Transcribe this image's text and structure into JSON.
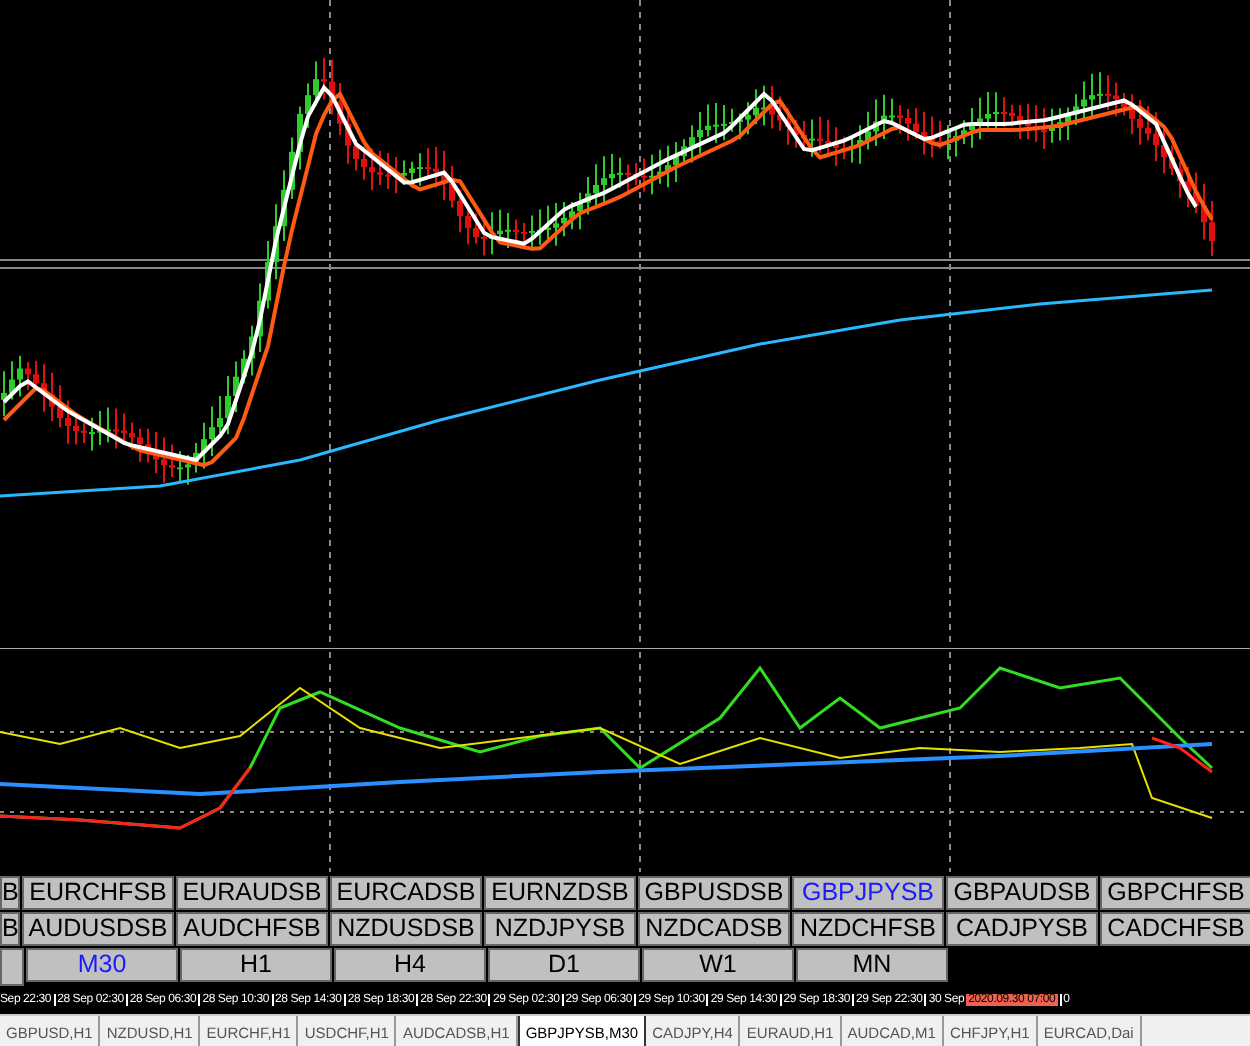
{
  "symbol_buttons": [
    [
      {
        "label": "B",
        "selected": false
      },
      {
        "label": "EURCHFSB",
        "selected": false
      },
      {
        "label": "EURAUDSB",
        "selected": false
      },
      {
        "label": "EURCADSB",
        "selected": false
      },
      {
        "label": "EURNZDSB",
        "selected": false
      },
      {
        "label": "GBPUSDSB",
        "selected": false
      },
      {
        "label": "GBPJPYSB",
        "selected": true
      },
      {
        "label": "GBPAUDSB",
        "selected": false
      },
      {
        "label": "GBPCHFSB",
        "selected": false
      }
    ],
    [
      {
        "label": "B",
        "selected": false
      },
      {
        "label": "AUDUSDSB",
        "selected": false
      },
      {
        "label": "AUDCHFSB",
        "selected": false
      },
      {
        "label": "NZDUSDSB",
        "selected": false
      },
      {
        "label": "NZDJPYSB",
        "selected": false
      },
      {
        "label": "NZDCADSB",
        "selected": false
      },
      {
        "label": "NZDCHFSB",
        "selected": false
      },
      {
        "label": "CADJPYSB",
        "selected": false
      },
      {
        "label": "CADCHFSB",
        "selected": false
      }
    ]
  ],
  "timeframe_buttons": [
    {
      "label": "M30",
      "selected": true
    },
    {
      "label": "H1",
      "selected": false
    },
    {
      "label": "H4",
      "selected": false
    },
    {
      "label": "D1",
      "selected": false
    },
    {
      "label": "W1",
      "selected": false
    },
    {
      "label": "MN",
      "selected": false
    }
  ],
  "time_axis": {
    "labels": [
      "Sep 22:30",
      "28 Sep 02:30",
      "28 Sep 06:30",
      "28 Sep 10:30",
      "28 Sep 14:30",
      "28 Sep 18:30",
      "28 Sep 22:30",
      "29 Sep 02:30",
      "29 Sep 06:30",
      "29 Sep 10:30",
      "29 Sep 14:30",
      "29 Sep 18:30",
      "29 Sep 22:30",
      "30 Sep"
    ],
    "current_time": "2020.09.30 07:00",
    "trailing": "0"
  },
  "tabs": [
    {
      "label": "GBPUSD,H1",
      "selected": false
    },
    {
      "label": "NZDUSD,H1",
      "selected": false
    },
    {
      "label": "EURCHF,H1",
      "selected": false
    },
    {
      "label": "USDCHF,H1",
      "selected": false
    },
    {
      "label": "AUDCADSB,H1",
      "selected": false
    },
    {
      "label": "GBPJPYSB,M30",
      "selected": true
    },
    {
      "label": "CADJPY,H4",
      "selected": false
    },
    {
      "label": "EURAUD,H1",
      "selected": false
    },
    {
      "label": "AUDCAD,M1",
      "selected": false
    },
    {
      "label": "CHFJPY,H1",
      "selected": false
    },
    {
      "label": "EURCAD,Dai",
      "selected": false
    }
  ]
}
